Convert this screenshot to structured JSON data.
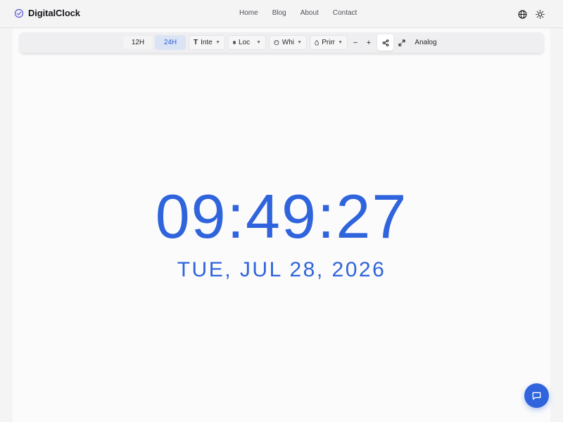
{
  "header": {
    "brand": "DigitalClock",
    "nav": [
      "Home",
      "Blog",
      "About",
      "Contact"
    ]
  },
  "toolbar": {
    "format_12": "12H",
    "format_24": "24H",
    "active_format": "24H",
    "font_select": "Inter",
    "timezone_select": "Loc",
    "theme_select": "White",
    "color_select": "Primary",
    "zoom_out": "−",
    "zoom_in": "+",
    "analog_label": "Analog"
  },
  "clock": {
    "time": "09:49:27",
    "date": "TUE, JUL 28, 2026"
  },
  "colors": {
    "accent": "#2f64dc",
    "active_tab_bg": "#dbe4f5"
  },
  "icons": {
    "brand": "clock-check-icon",
    "language": "globe-icon",
    "theme": "sun-icon",
    "font": "type-icon",
    "timezone": "dot-icon",
    "theme_select": "palette-icon",
    "color": "droplet-icon",
    "share": "share-icon",
    "fullscreen": "expand-icon",
    "chat": "chat-icon"
  }
}
